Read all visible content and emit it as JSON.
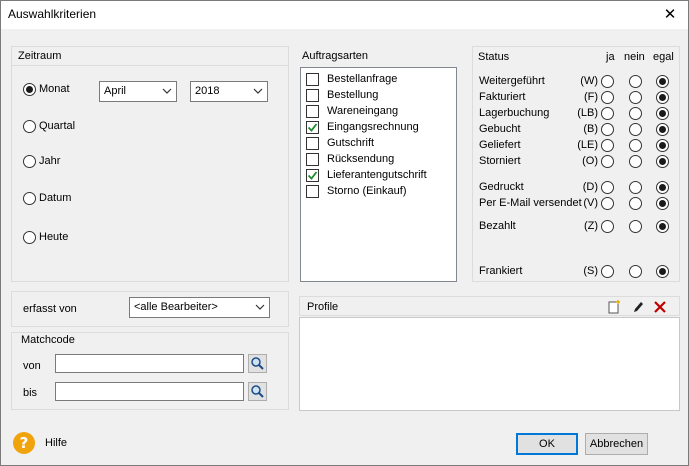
{
  "window": {
    "title": "Auswahlkriterien"
  },
  "zeitraum": {
    "label": "Zeitraum",
    "options": [
      "Monat",
      "Quartal",
      "Jahr",
      "Datum",
      "Heute"
    ],
    "selected_index": 0,
    "month_value": "April",
    "year_value": "2018"
  },
  "auftragsarten": {
    "label": "Auftragsarten",
    "items": [
      {
        "label": "Bestellanfrage",
        "checked": false
      },
      {
        "label": "Bestellung",
        "checked": false
      },
      {
        "label": "Wareneingang",
        "checked": false
      },
      {
        "label": "Eingangsrechnung",
        "checked": true
      },
      {
        "label": "Gutschrift",
        "checked": false
      },
      {
        "label": "Rücksendung",
        "checked": false
      },
      {
        "label": "Lieferantengutschrift",
        "checked": true
      },
      {
        "label": "Storno (Einkauf)",
        "checked": false
      }
    ]
  },
  "status": {
    "label": "Status",
    "col_ja": "ja",
    "col_nein": "nein",
    "col_egal": "egal",
    "rows": [
      {
        "label": "Weitergeführt",
        "code": "(W)",
        "value": "egal"
      },
      {
        "label": "Fakturiert",
        "code": "(F)",
        "value": "egal"
      },
      {
        "label": "Lagerbuchung",
        "code": "(LB)",
        "value": "egal"
      },
      {
        "label": "Gebucht",
        "code": "(B)",
        "value": "egal"
      },
      {
        "label": "Geliefert",
        "code": "(LE)",
        "value": "egal"
      },
      {
        "label": "Storniert",
        "code": "(O)",
        "value": "egal"
      },
      {
        "label": "Gedruckt",
        "code": "(D)",
        "value": "egal"
      },
      {
        "label": "Per E-Mail versendet",
        "code": "(V)",
        "value": "egal"
      },
      {
        "label": "Bezahlt",
        "code": "(Z)",
        "value": "egal"
      },
      {
        "label": "Frankiert",
        "code": "(S)",
        "value": "egal"
      }
    ]
  },
  "erfasst": {
    "label": "erfasst von",
    "value": "<alle Bearbeiter>"
  },
  "matchcode": {
    "label": "Matchcode",
    "von_label": "von",
    "bis_label": "bis",
    "von_value": "",
    "bis_value": ""
  },
  "profile": {
    "label": "Profile"
  },
  "footer": {
    "help_label": "Hilfe",
    "ok_label": "OK",
    "cancel_label": "Abbrechen"
  },
  "colors": {
    "help_icon": "#f0a30a",
    "delete_icon": "#c00000",
    "default_border": "#0078d7"
  },
  "icons": {
    "help": "question-circle-icon",
    "search": "magnifier-icon",
    "new_profile": "new-document-icon",
    "edit_profile": "pencil-icon",
    "delete_profile": "delete-x-icon",
    "dropdown": "chevron-down-icon",
    "close": "close-icon"
  }
}
